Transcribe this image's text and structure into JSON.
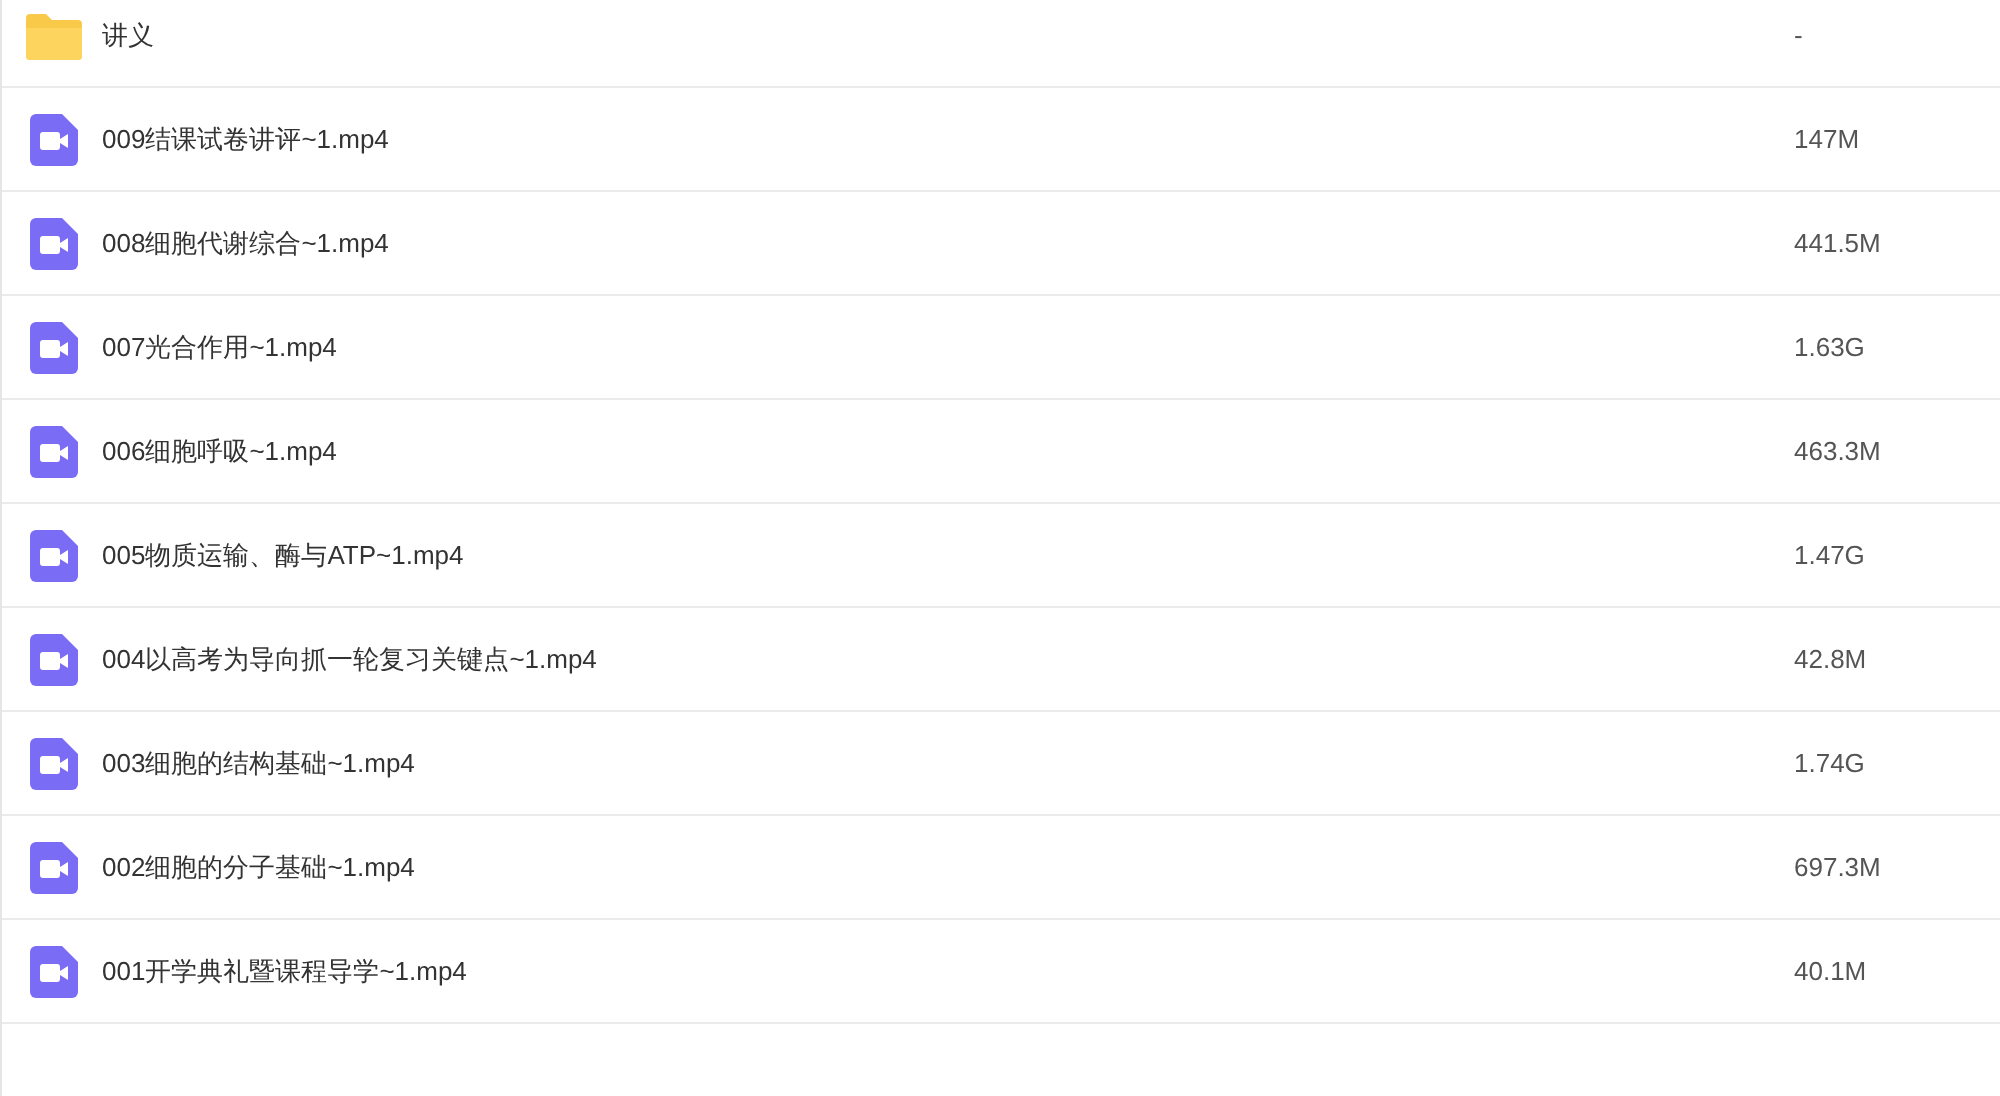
{
  "files": [
    {
      "kind": "folder",
      "name": "讲义",
      "size": "-"
    },
    {
      "kind": "video",
      "name": "009结课试卷讲评~1.mp4",
      "size": "147M"
    },
    {
      "kind": "video",
      "name": "008细胞代谢综合~1.mp4",
      "size": "441.5M"
    },
    {
      "kind": "video",
      "name": "007光合作用~1.mp4",
      "size": "1.63G"
    },
    {
      "kind": "video",
      "name": "006细胞呼吸~1.mp4",
      "size": "463.3M"
    },
    {
      "kind": "video",
      "name": "005物质运输、酶与ATP~1.mp4",
      "size": "1.47G"
    },
    {
      "kind": "video",
      "name": "004以高考为导向抓一轮复习关键点~1.mp4",
      "size": "42.8M"
    },
    {
      "kind": "video",
      "name": "003细胞的结构基础~1.mp4",
      "size": "1.74G"
    },
    {
      "kind": "video",
      "name": "002细胞的分子基础~1.mp4",
      "size": "697.3M"
    },
    {
      "kind": "video",
      "name": "001开学典礼暨课程导学~1.mp4",
      "size": "40.1M"
    }
  ]
}
